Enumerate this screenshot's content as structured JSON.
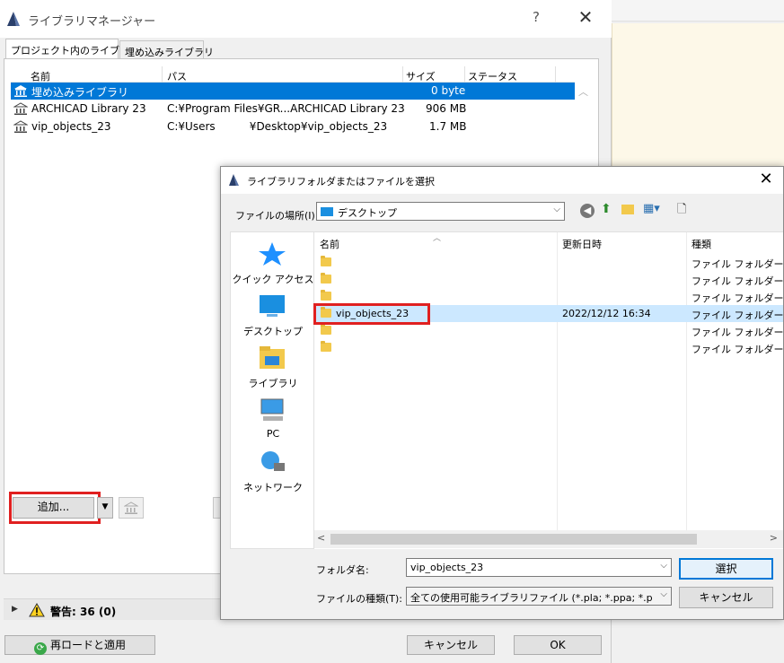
{
  "library_manager": {
    "title": "ライブラリマネージャー",
    "help": "?",
    "close": "✕",
    "tabs": [
      "プロジェクト内のライブラリ",
      "埋め込みライブラリ"
    ],
    "columns": {
      "name": "名前",
      "path": "パス",
      "size": "サイズ",
      "status": "ステータス"
    },
    "rows": [
      {
        "name": "埋め込みライブラリ",
        "path": "",
        "size": "0 byte",
        "selected": true
      },
      {
        "name": "ARCHICAD Library 23",
        "path": "C:¥Program Files¥GR...ARCHICAD Library 23",
        "size": "906 MB"
      },
      {
        "name": "vip_objects_23",
        "path": "C:¥Users          ¥Desktop¥vip_objects_23",
        "size": "1.7 MB"
      }
    ],
    "add_button": "追加...",
    "warning": "警告: 36 (0)",
    "reload_button": "再ロードと適用",
    "cancel_button": "キャンセル",
    "ok_button": "OK"
  },
  "file_dialog": {
    "title": "ライブラリフォルダまたはファイルを選択",
    "location_label": "ファイルの場所(I):",
    "location_value": "デスクトップ",
    "places": [
      "クイック アクセス",
      "デスクトップ",
      "ライブラリ",
      "PC",
      "ネットワーク"
    ],
    "columns": {
      "name": "名前",
      "modified": "更新日時",
      "type": "種類"
    },
    "files": [
      {
        "name": "",
        "modified": "",
        "type": "ファイル フォルダー"
      },
      {
        "name": "",
        "modified": "",
        "type": "ファイル フォルダー"
      },
      {
        "name": "",
        "modified": "",
        "type": "ファイル フォルダー"
      },
      {
        "name": "vip_objects_23",
        "modified": "2022/12/12 16:34",
        "type": "ファイル フォルダー",
        "selected": true
      },
      {
        "name": "",
        "modified": "",
        "type": "ファイル フォルダー"
      },
      {
        "name": "",
        "modified": "",
        "type": "ファイル フォルダー"
      }
    ],
    "folder_name_label": "フォルダ名:",
    "folder_name_value": "vip_objects_23",
    "file_type_label": "ファイルの種類(T):",
    "file_type_value": "全ての使用可能ライブラリファイル (*.pla; *.ppa; *.pca; *.lc",
    "select_button": "選択",
    "cancel_button": "キャンセル"
  },
  "colors": {
    "selection": "#0078d7",
    "highlight_box": "#e02020",
    "folder": "#f2c94c"
  }
}
